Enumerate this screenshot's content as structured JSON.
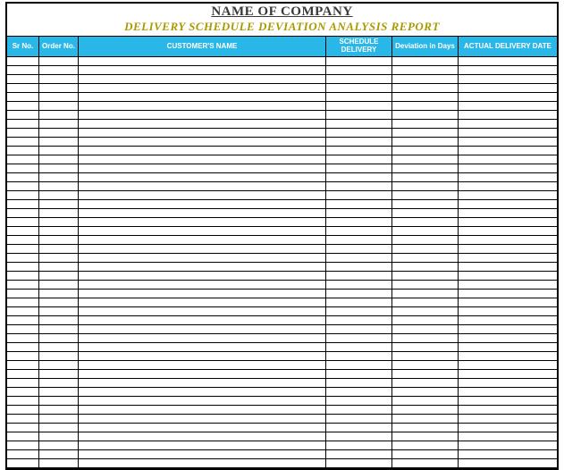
{
  "header": {
    "company_name": "NAME OF COMPANY",
    "report_title": "DELIVERY SCHEDULE DEVIATION ANALYSIS REPORT"
  },
  "columns": {
    "sr_no": "Sr No.",
    "order_no": "Order No.",
    "customer_name": "CUSTOMER'S NAME",
    "schedule_delivery": "SCHEDULE DELIVERY",
    "deviation_days": "Deviation in Days",
    "actual_delivery_date": "ACTUAL DELIVERY DATE"
  },
  "rows_count": 46
}
